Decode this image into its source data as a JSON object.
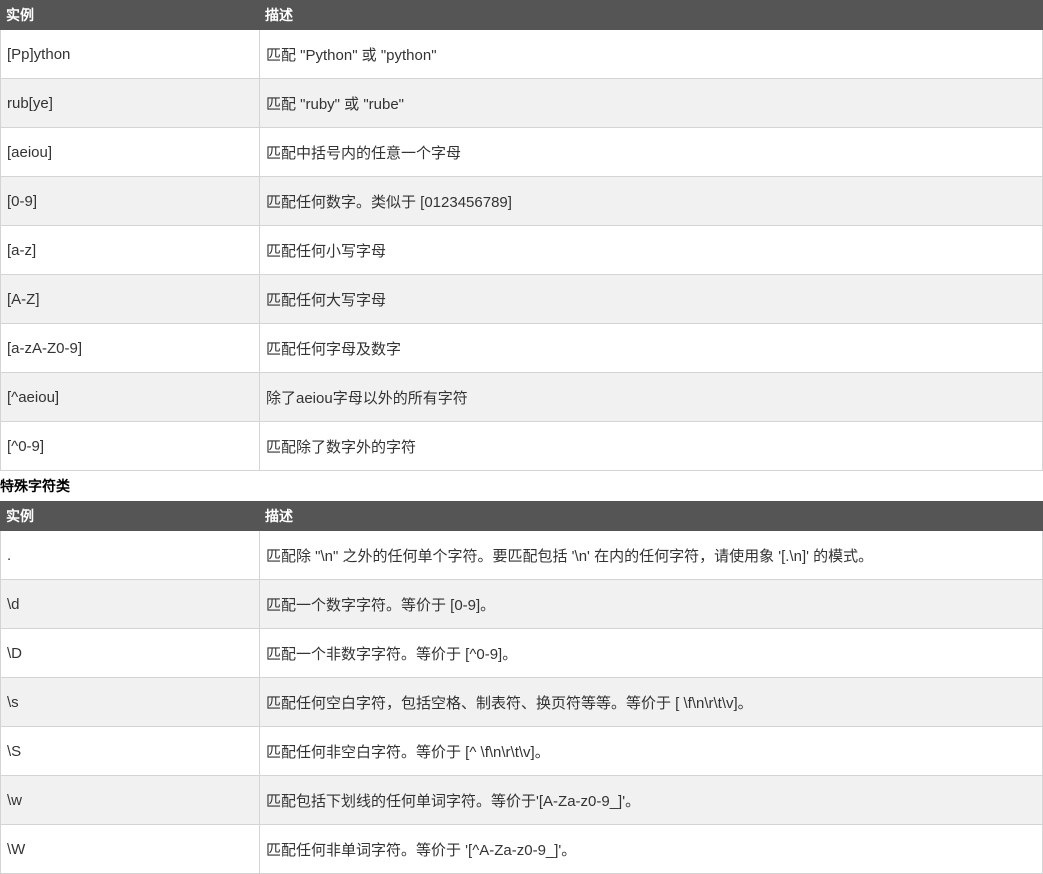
{
  "table1": {
    "headers": [
      "实例",
      "描述"
    ],
    "rows": [
      [
        "[Pp]ython",
        "匹配 \"Python\" 或 \"python\""
      ],
      [
        "rub[ye]",
        "匹配 \"ruby\" 或 \"rube\""
      ],
      [
        "[aeiou]",
        "匹配中括号内的任意一个字母"
      ],
      [
        "[0-9]",
        "匹配任何数字。类似于 [0123456789]"
      ],
      [
        "[a-z]",
        "匹配任何小写字母"
      ],
      [
        "[A-Z]",
        "匹配任何大写字母"
      ],
      [
        "[a-zA-Z0-9]",
        "匹配任何字母及数字"
      ],
      [
        "[^aeiou]",
        "除了aeiou字母以外的所有字符"
      ],
      [
        "[^0-9]",
        "匹配除了数字外的字符"
      ]
    ]
  },
  "section2_title": "特殊字符类",
  "table2": {
    "headers": [
      "实例",
      "描述"
    ],
    "rows": [
      [
        ".",
        "匹配除 \"\\n\" 之外的任何单个字符。要匹配包括 '\\n' 在内的任何字符，请使用象 '[.\\n]' 的模式。"
      ],
      [
        "\\d",
        "匹配一个数字字符。等价于 [0-9]。"
      ],
      [
        "\\D",
        "匹配一个非数字字符。等价于 [^0-9]。"
      ],
      [
        "\\s",
        "匹配任何空白字符，包括空格、制表符、换页符等等。等价于 [ \\f\\n\\r\\t\\v]。"
      ],
      [
        "\\S",
        "匹配任何非空白字符。等价于 [^ \\f\\n\\r\\t\\v]。"
      ],
      [
        "\\w",
        "匹配包括下划线的任何单词字符。等价于'[A-Za-z0-9_]'。"
      ],
      [
        "\\W",
        "匹配任何非单词字符。等价于 '[^A-Za-z0-9_]'。"
      ]
    ]
  }
}
